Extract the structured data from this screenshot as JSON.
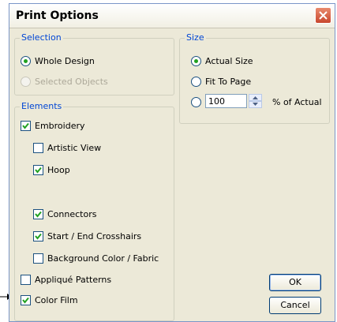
{
  "dialog": {
    "title": "Print Options",
    "close_label": "close"
  },
  "selection": {
    "legend": "Selection",
    "options": [
      {
        "label": "Whole Design",
        "selected": true,
        "enabled": true
      },
      {
        "label": "Selected Objects",
        "selected": false,
        "enabled": false
      }
    ]
  },
  "size": {
    "legend": "Size",
    "options": [
      {
        "label": "Actual Size",
        "selected": true
      },
      {
        "label": "Fit To Page",
        "selected": false
      },
      {
        "label": "",
        "selected": false
      }
    ],
    "percent_value": "100",
    "percent_suffix": "% of Actual"
  },
  "elements": {
    "legend": "Elements",
    "items": [
      {
        "label": "Embroidery",
        "checked": true
      },
      {
        "label": "Artistic View",
        "checked": false
      },
      {
        "label": "Hoop",
        "checked": true
      },
      {
        "label": "Connectors",
        "checked": true
      },
      {
        "label": "Start / End Crosshairs",
        "checked": true
      },
      {
        "label": "Background Color / Fabric",
        "checked": false
      },
      {
        "label": "Appliqué Patterns",
        "checked": false
      },
      {
        "label": "Color Film",
        "checked": true
      }
    ]
  },
  "buttons": {
    "ok_label": "OK",
    "cancel_label": "Cancel"
  },
  "colors": {
    "legend_text": "#0046d5",
    "radio_dot": "#21a121",
    "check_mark": "#21a121"
  }
}
